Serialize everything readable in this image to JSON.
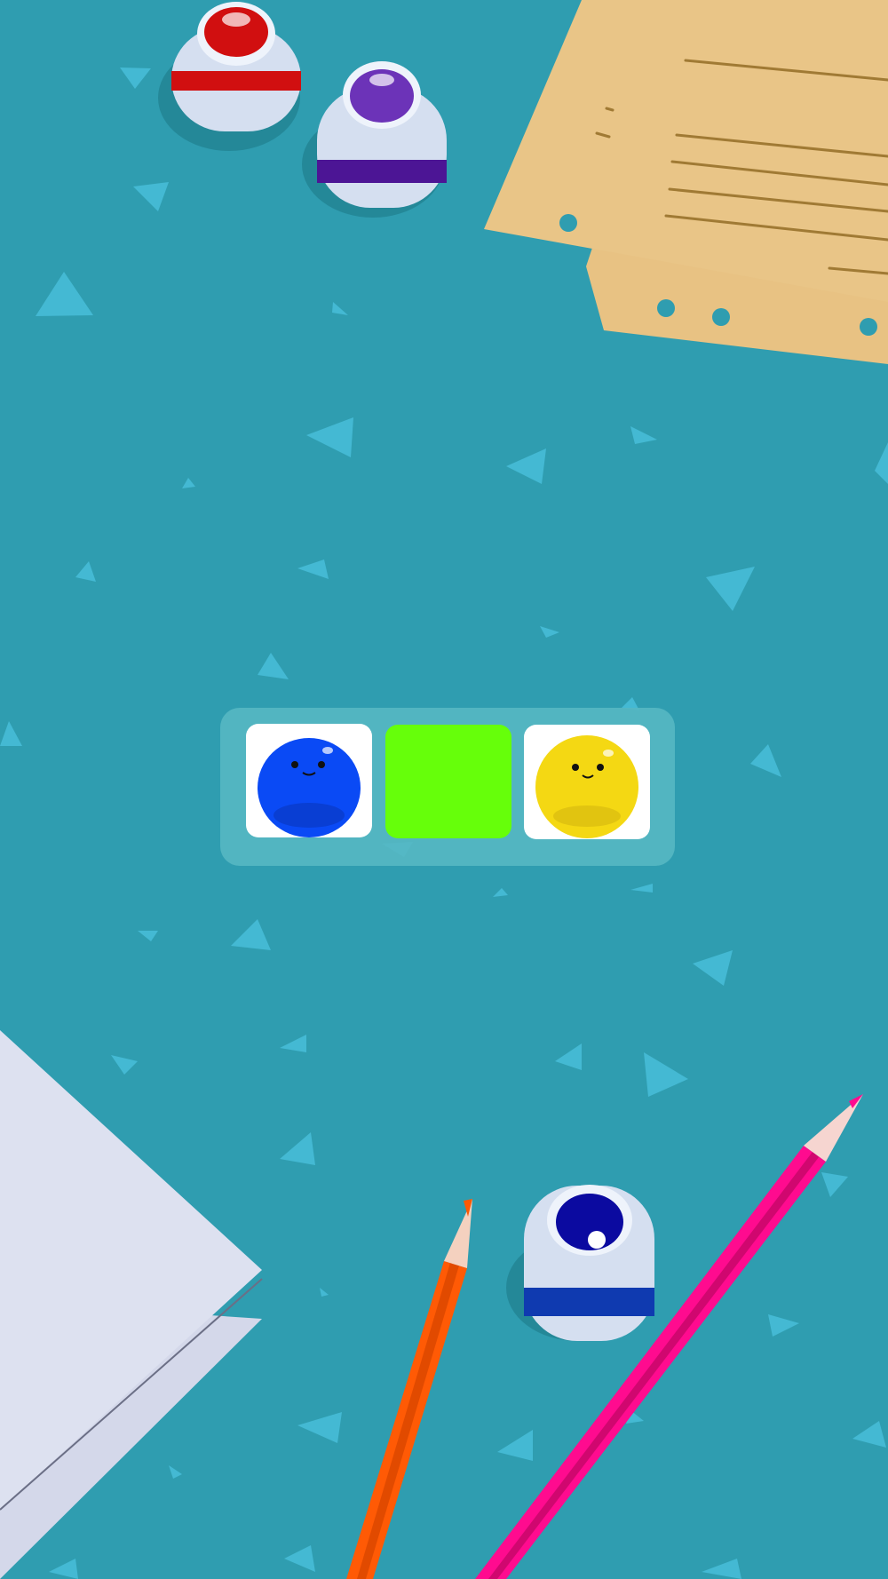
{
  "game": {
    "background_color": "#2f9db0",
    "triangle_color": "#44b9d3",
    "tray": {
      "slots": [
        {
          "id": "slot-1",
          "content": "blob",
          "color": "#0a4af5",
          "face": "smiling"
        },
        {
          "id": "slot-2",
          "content": "paint",
          "color": "#66ff0a"
        },
        {
          "id": "slot-3",
          "content": "blob",
          "color": "#f4d813",
          "face": "smiling"
        }
      ]
    },
    "paint_pots": [
      {
        "id": "red-pot",
        "color": "#d10f10",
        "stripe": "#c30e0e"
      },
      {
        "id": "purple-pot",
        "color": "#6c33b8",
        "stripe": "#4c1595"
      },
      {
        "id": "blue-pot",
        "color": "#0b0aa0",
        "stripe": "#0f3ab0"
      }
    ],
    "props": [
      "paper-sheet-top-right",
      "paper-sheet-bottom-left",
      "orange-pencil",
      "pink-pencil"
    ]
  }
}
